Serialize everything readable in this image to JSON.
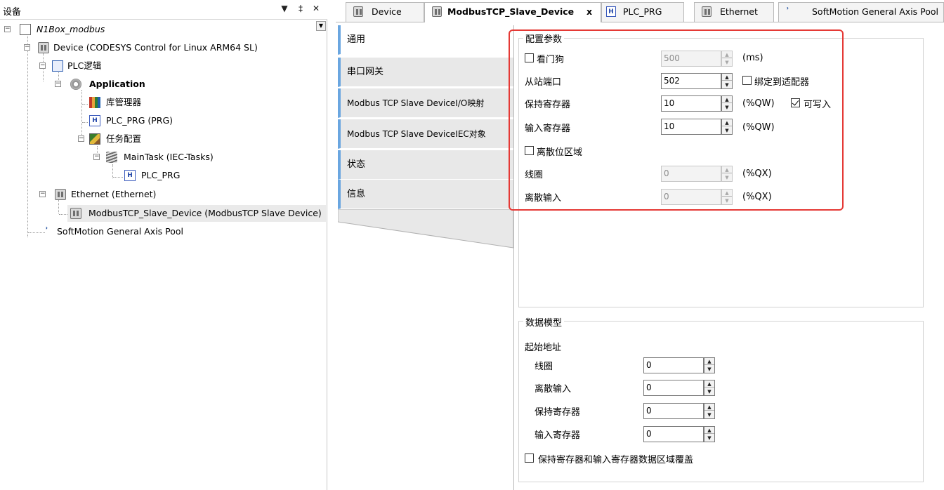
{
  "left_panel": {
    "title": "设备",
    "header_buttons": [
      "▼",
      "‡",
      "✕"
    ],
    "tree": {
      "root": "N1Box_modbus",
      "device": "Device (CODESYS Control for Linux ARM64 SL)",
      "plc_logic": "PLC逻辑",
      "application": "Application",
      "library_manager": "库管理器",
      "plc_prg": "PLC_PRG (PRG)",
      "task_config": "任务配置",
      "main_task": "MainTask (IEC-Tasks)",
      "main_task_prg": "PLC_PRG",
      "ethernet": "Ethernet (Ethernet)",
      "modbus_slave": "ModbusTCP_Slave_Device (ModbusTCP Slave Device)",
      "softmotion": "SoftMotion General Axis Pool"
    }
  },
  "tabs": [
    {
      "label": "Device"
    },
    {
      "label": "ModbusTCP_Slave_Device",
      "close": "x"
    },
    {
      "label": "PLC_PRG"
    },
    {
      "label": "Ethernet"
    },
    {
      "label": "SoftMotion General Axis Pool"
    }
  ],
  "side_tabs": [
    "通用",
    "串口网关",
    "Modbus TCP Slave DeviceI/O映射",
    "Modbus TCP Slave DeviceIEC对象",
    "状态",
    "信息"
  ],
  "config": {
    "title": "配置参数",
    "watchdog_label": "看门狗",
    "watchdog_value": "500",
    "watchdog_unit": "(ms)",
    "slave_port_label": "从站端口",
    "slave_port_value": "502",
    "bind_adapter_label": "绑定到适配器",
    "holding_label": "保持寄存器",
    "holding_value": "10",
    "holding_unit": "(%QW)",
    "writable_label": "可写入",
    "input_label": "输入寄存器",
    "input_value": "10",
    "input_unit": "(%QW)",
    "discrete_area_label": "离散位区域",
    "coil_label": "线圈",
    "coil_value": "0",
    "coil_unit": "(%QX)",
    "discrete_input_label": "离散输入",
    "discrete_input_value": "0",
    "discrete_input_unit": "(%QX)"
  },
  "data_model": {
    "title": "数据模型",
    "start_address_label": "起始地址",
    "coil_label": "线圈",
    "coil_value": "0",
    "discrete_input_label": "离散输入",
    "discrete_input_value": "0",
    "holding_label": "保持寄存器",
    "holding_value": "0",
    "input_label": "输入寄存器",
    "input_value": "0",
    "overlap_label": "保持寄存器和输入寄存器数据区域覆盖"
  },
  "colors": {
    "highlight_box": "#e53935",
    "side_tab_accent": "#6aa6e0"
  }
}
